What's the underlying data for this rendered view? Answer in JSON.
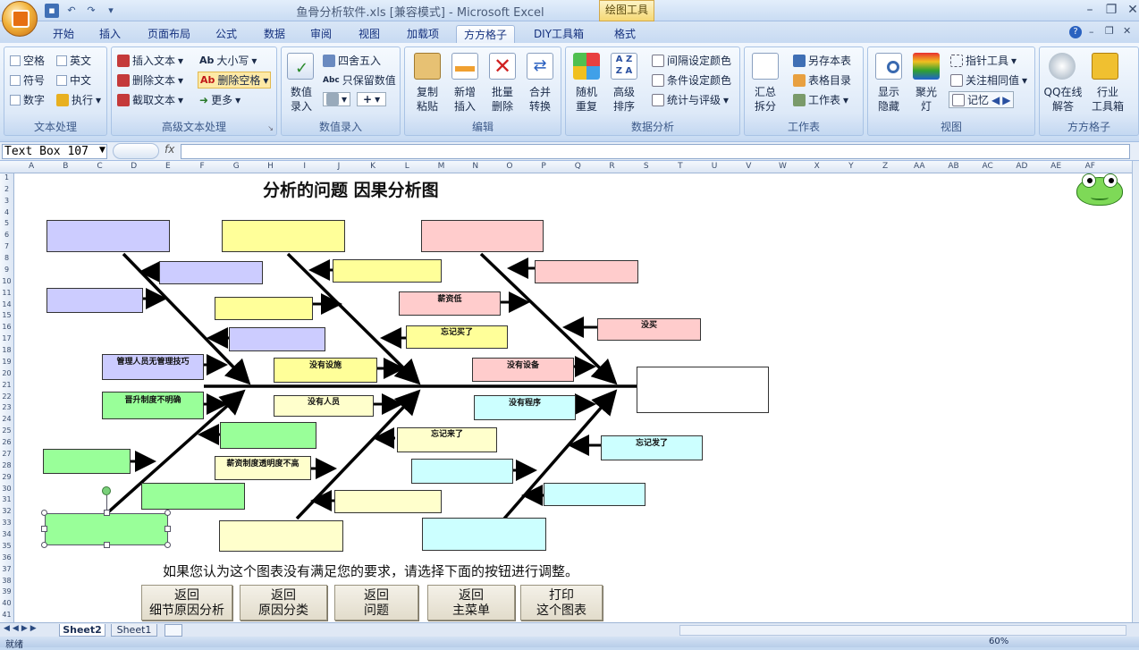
{
  "window": {
    "title": "鱼骨分析软件.xls  [兼容模式] - Microsoft Excel",
    "contextual_tab": "绘图工具"
  },
  "tabs": [
    "开始",
    "插入",
    "页面布局",
    "公式",
    "数据",
    "审阅",
    "视图",
    "加载项",
    "方方格子",
    "DIY工具箱",
    "格式"
  ],
  "active_tab": "方方格子",
  "ribbon": {
    "text_processing": {
      "label": "文本处理",
      "items": [
        "空格",
        "英文",
        "符号",
        "中文",
        "数字",
        "执行"
      ]
    },
    "adv_text": {
      "label": "高级文本处理",
      "items": [
        "插入文本",
        "删除文本",
        "截取文本",
        "大小写",
        "删除空格",
        "更多"
      ]
    },
    "data_entry": {
      "label": "数值录入",
      "big": "数值\n录入",
      "items": [
        "四舍五入",
        "只保留数值"
      ]
    },
    "edit": {
      "label": "编辑",
      "items": [
        "复制\n粘贴",
        "新增\n插入",
        "批量\n删除",
        "合并\n转换"
      ]
    },
    "analysis": {
      "label": "数据分析",
      "items": [
        "随机\n重复",
        "高级\n排序",
        "间隔设定颜色",
        "条件设定颜色",
        "统计与评级"
      ]
    },
    "worksheet": {
      "label": "工作表",
      "items": [
        "汇总\n拆分",
        "另存本表",
        "表格目录",
        "工作表"
      ]
    },
    "view": {
      "label": "视图",
      "items": [
        "显示\n隐藏",
        "聚光\n灯",
        "指针工具",
        "关注相同值",
        "记忆"
      ]
    },
    "fangfang": {
      "label": "方方格子",
      "items": [
        "QQ在线\n解答",
        "行业\n工具箱"
      ]
    }
  },
  "name_box": "Text Box 107",
  "fx_label": "fx",
  "columns": [
    "A",
    "B",
    "C",
    "D",
    "E",
    "F",
    "G",
    "H",
    "I",
    "J",
    "K",
    "L",
    "M",
    "N",
    "O",
    "P",
    "Q",
    "R",
    "S",
    "T",
    "U",
    "V",
    "W",
    "X",
    "Y",
    "Z",
    "AA",
    "AB",
    "AC",
    "AD",
    "AE",
    "AF"
  ],
  "rows": [
    "1",
    "2",
    "3",
    "4",
    "5",
    "6",
    "7",
    "8",
    "9",
    "10",
    "11",
    "14",
    "15",
    "16",
    "17",
    "18",
    "19",
    "20",
    "21",
    "22",
    "23",
    "24",
    "25",
    "26",
    "27",
    "28",
    "29",
    "30",
    "31",
    "32",
    "33",
    "34",
    "35",
    "36",
    "37",
    "38",
    "39",
    "40",
    "41"
  ],
  "sheet": {
    "title": "分析的问题 因果分析图",
    "prompt": "如果您认为这个图表没有满足您的要求，请选择下面的按钮进行调整。",
    "labels": {
      "mgmt_skill": "管理人员无管理技巧",
      "raise_system": "晋升制度不明确",
      "rule_unclear": "薪资制度透明度不高",
      "no_facility": "没有设施",
      "no_people": "没有人员",
      "forgot_buy": "忘记买了",
      "forgot_come": "忘记来了",
      "salary_low": "薪资低",
      "no_equipment": "没有设备",
      "no_procedure": "没有程序",
      "no_buy": "没买",
      "forgot_sent": "忘记发了"
    },
    "buttons": [
      {
        "line1": "返回",
        "line2": "细节原因分析"
      },
      {
        "line1": "返回",
        "line2": "原因分类"
      },
      {
        "line1": "返回",
        "line2": "问题"
      },
      {
        "line1": "返回",
        "line2": "主菜单"
      },
      {
        "line1": "打印",
        "line2": "这个图表"
      }
    ]
  },
  "sheet_tabs": [
    "Sheet2",
    "Sheet1"
  ],
  "status": {
    "left": "就绪",
    "zoom": "60%"
  }
}
